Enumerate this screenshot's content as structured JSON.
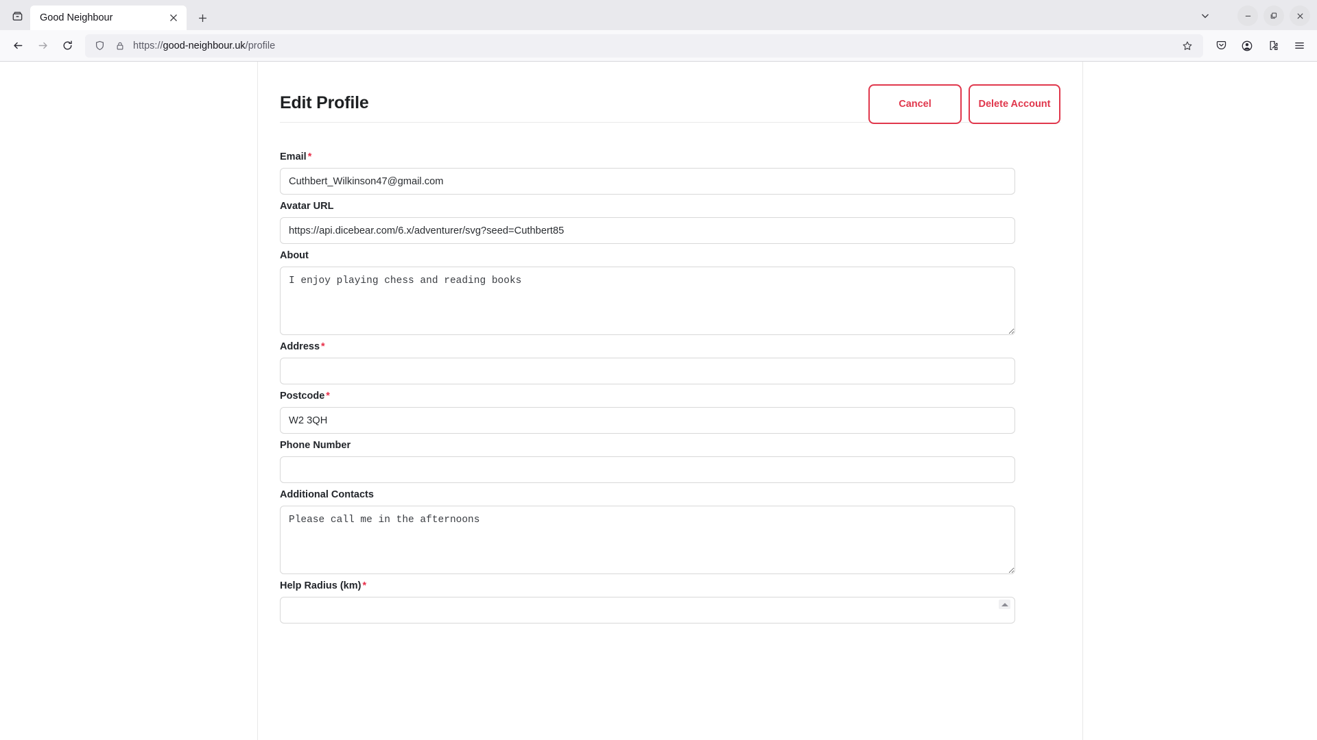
{
  "browser": {
    "container_icon": "container-tabs-icon",
    "tab": {
      "title": "Good Neighbour",
      "close_label": "×"
    },
    "new_tab_label": "+",
    "list_all_tabs_label": "⌄",
    "window_controls": {
      "minimize": "—",
      "maximize": "❐",
      "close": "×"
    },
    "nav": {
      "back_label": "←",
      "forward_label": "→",
      "reload_label": "⟳"
    },
    "url": {
      "scheme": "https://",
      "host": "good-neighbour.uk",
      "path": "/profile",
      "full": "https://good-neighbour.uk/profile",
      "shield_icon": "tracking-protection-shield-icon",
      "lock_icon": "padlock-icon",
      "bookmark_icon": "bookmark-star-icon"
    },
    "toolbar_icons": [
      {
        "name": "pocket-save-icon"
      },
      {
        "name": "account-circle-icon"
      },
      {
        "name": "extensions-puzzle-icon"
      },
      {
        "name": "application-menu-icon"
      }
    ]
  },
  "page": {
    "title": "Edit Profile",
    "actions": {
      "cancel": "Cancel",
      "delete_account": "Delete Account"
    },
    "accent_danger": "#e0374c",
    "required_marker": "*",
    "fields": [
      {
        "id": "email",
        "label": "Email",
        "required": true,
        "type": "text",
        "value": "Cuthbert_Wilkinson47@gmail.com",
        "placeholder": ""
      },
      {
        "id": "avatar-url",
        "label": "Avatar URL",
        "required": false,
        "type": "text",
        "value": "https://api.dicebear.com/6.x/adventurer/svg?seed=Cuthbert85",
        "placeholder": ""
      },
      {
        "id": "about",
        "label": "About",
        "required": false,
        "type": "textarea",
        "value": "I enjoy playing chess and reading books",
        "placeholder": ""
      },
      {
        "id": "address",
        "label": "Address",
        "required": true,
        "type": "text",
        "value": "",
        "placeholder": ""
      },
      {
        "id": "postcode",
        "label": "Postcode",
        "required": true,
        "type": "text",
        "value": "W2 3QH",
        "placeholder": ""
      },
      {
        "id": "phone-number",
        "label": "Phone Number",
        "required": false,
        "type": "text",
        "value": "",
        "placeholder": ""
      },
      {
        "id": "additional-contacts",
        "label": "Additional Contacts",
        "required": false,
        "type": "textarea",
        "value": "Please call me in the afternoons",
        "placeholder": ""
      },
      {
        "id": "help-radius",
        "label": "Help Radius (km)",
        "required": true,
        "type": "number",
        "value": "",
        "placeholder": ""
      }
    ]
  }
}
